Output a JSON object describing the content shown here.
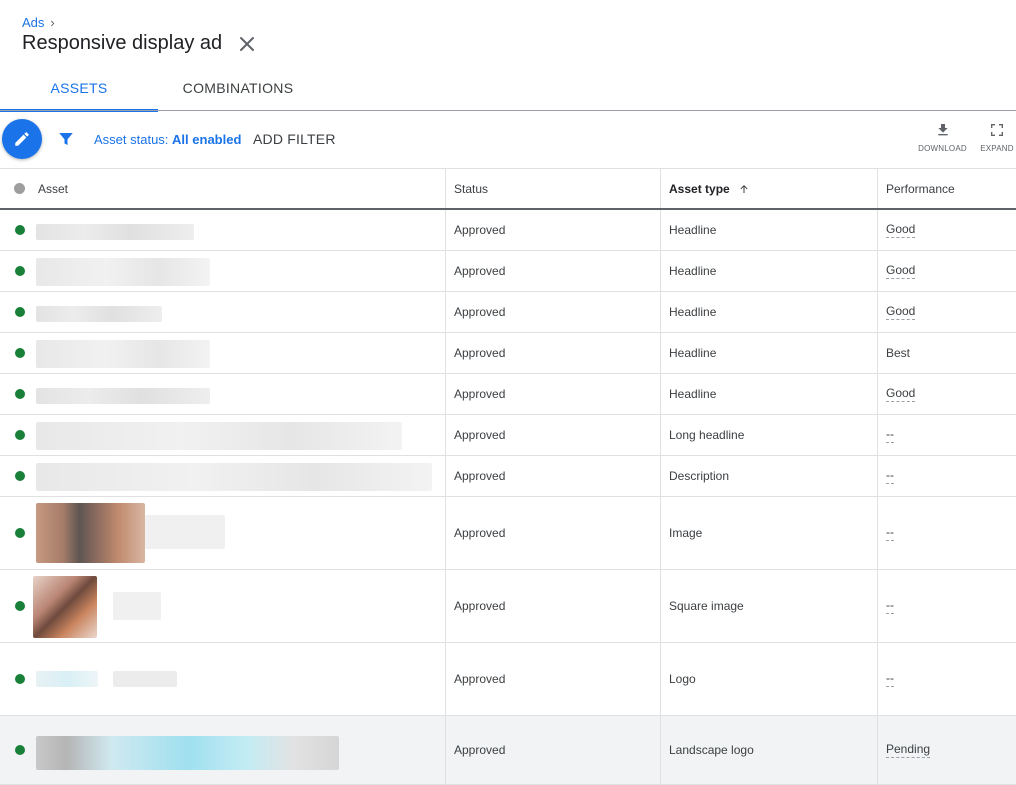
{
  "breadcrumb": {
    "parent": "Ads",
    "separator": "›"
  },
  "title": "Responsive display ad",
  "tabs": [
    {
      "label": "ASSETS",
      "active": true
    },
    {
      "label": "COMBINATIONS",
      "active": false
    }
  ],
  "toolbar": {
    "filter_prefix": "Asset status:",
    "filter_value": "All enabled",
    "add_filter": "ADD FILTER",
    "download": "DOWNLOAD",
    "expand": "EXPAND"
  },
  "colors": {
    "accent": "#1a73e8",
    "status_enabled": "#188038"
  },
  "table": {
    "columns": [
      "Asset",
      "Status",
      "Asset type",
      "Performance"
    ],
    "sort": {
      "column": "Asset type",
      "direction": "ascending"
    },
    "rows": [
      {
        "status": "Approved",
        "type": "Headline",
        "performance": "Good"
      },
      {
        "status": "Approved",
        "type": "Headline",
        "performance": "Good"
      },
      {
        "status": "Approved",
        "type": "Headline",
        "performance": "Good"
      },
      {
        "status": "Approved",
        "type": "Headline",
        "performance": "Best"
      },
      {
        "status": "Approved",
        "type": "Headline",
        "performance": "Good"
      },
      {
        "status": "Approved",
        "type": "Long headline",
        "performance": "--"
      },
      {
        "status": "Approved",
        "type": "Description",
        "performance": "--"
      },
      {
        "status": "Approved",
        "type": "Image",
        "performance": "--"
      },
      {
        "status": "Approved",
        "type": "Square image",
        "performance": "--"
      },
      {
        "status": "Approved",
        "type": "Logo",
        "performance": "--"
      },
      {
        "status": "Approved",
        "type": "Landscape logo",
        "performance": "Pending"
      }
    ]
  }
}
